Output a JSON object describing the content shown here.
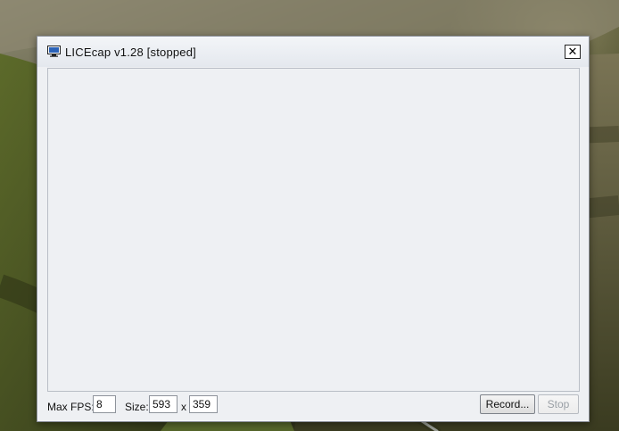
{
  "window": {
    "title": "LICEcap v1.28 [stopped]",
    "close_glyph": "✕"
  },
  "controls": {
    "max_fps_label": "Max FPS:",
    "max_fps_value": "8",
    "size_label": "Size:",
    "width_value": "593",
    "size_separator": "x",
    "height_value": "359",
    "record_label": "Record...",
    "stop_label": "Stop"
  },
  "icons": {
    "app": "monitor-icon",
    "close": "close-icon"
  }
}
